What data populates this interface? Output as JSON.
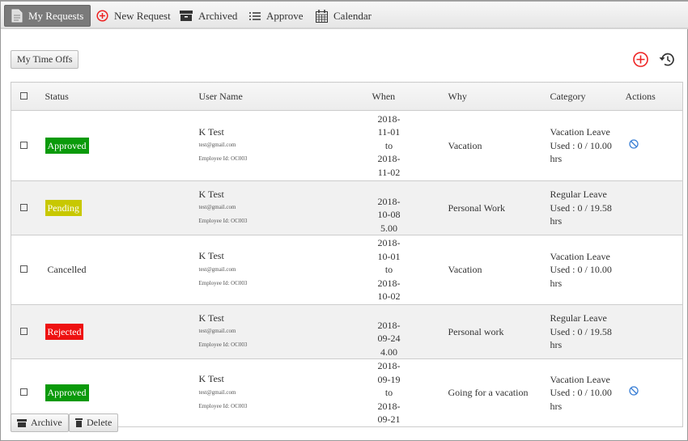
{
  "nav": {
    "tabs": [
      {
        "label": "My Requests",
        "icon": "document-icon"
      },
      {
        "label": "New Request",
        "icon": "plus-circle-icon"
      },
      {
        "label": "Archived",
        "icon": "archive-icon"
      },
      {
        "label": "Approve",
        "icon": "list-icon"
      },
      {
        "label": "Calendar",
        "icon": "calendar-icon"
      }
    ]
  },
  "toolbar": {
    "my_time_offs": "My Time Offs"
  },
  "table": {
    "headers": [
      "Status",
      "User Name",
      "When",
      "Why",
      "Category",
      "Actions"
    ],
    "rows": [
      {
        "status": "Approved",
        "status_color": "#0a9a0a",
        "name": "K Test",
        "email": "test@gmail.com",
        "emp": "Employee Id: OC003",
        "when1": "2018-11-01",
        "when2": "to",
        "when3": "2018-11-02",
        "why": "Vacation",
        "cat1": "Vacation Leave",
        "cat2": "Used : 0 / 10.00",
        "cat3": "hrs",
        "action": "cancel-icon"
      },
      {
        "status": "Pending",
        "status_color": "#c8c800",
        "name": "K Test",
        "email": "test@gmail.com",
        "emp": "Employee Id: OC003",
        "when1": "",
        "when2": "2018-10-08",
        "when3": "5.00",
        "why": "Personal Work",
        "cat1": "Regular Leave",
        "cat2": "Used : 0 / 19.58",
        "cat3": "hrs"
      },
      {
        "status": "Cancelled",
        "name": "K Test",
        "email": "test@gmail.com",
        "emp": "Employee Id: OC003",
        "when1": "2018-10-01",
        "when2": "to",
        "when3": "2018-10-02",
        "why": "Vacation",
        "cat1": "Vacation Leave",
        "cat2": "Used : 0 / 10.00",
        "cat3": "hrs"
      },
      {
        "status": "Rejected",
        "status_color": "#ee1111",
        "name": "K Test",
        "email": "test@gmail.com",
        "emp": "Employee Id: OC003",
        "when1": "",
        "when2": "2018-09-24",
        "when3": "4.00",
        "why": "Personal work",
        "cat1": "Regular Leave",
        "cat2": "Used : 0 / 19.58",
        "cat3": "hrs"
      },
      {
        "status": "Approved",
        "status_color": "#0a9a0a",
        "name": "K Test",
        "email": "test@gmail.com",
        "emp": "Employee Id: OC003",
        "when1": "2018-09-19",
        "when2": "to",
        "when3": "2018-09-21",
        "why": "Going for a vacation",
        "cat1": "Vacation Leave",
        "cat2": "Used : 0 / 10.00",
        "cat3": "hrs",
        "action": "cancel-icon"
      }
    ]
  },
  "footer": {
    "archive": "Archive",
    "delete": "Delete"
  }
}
